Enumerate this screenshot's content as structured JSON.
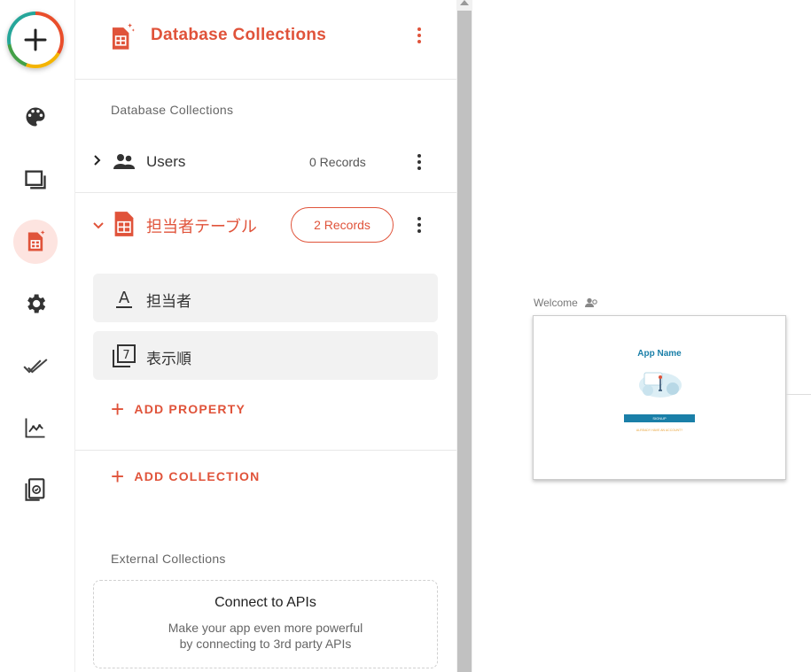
{
  "colors": {
    "accent": "#e0533a",
    "app_primary": "#1a7fa8",
    "active_bg": "#fde4e0"
  },
  "rail": {
    "add_icon": "plus-icon",
    "items": [
      {
        "name": "palette-icon"
      },
      {
        "name": "screens-icon"
      },
      {
        "name": "database-icon",
        "active": true
      },
      {
        "name": "gear-icon"
      },
      {
        "name": "double-check-icon"
      },
      {
        "name": "analytics-icon"
      },
      {
        "name": "publish-icon"
      }
    ]
  },
  "panel": {
    "title": "Database Collections",
    "section_label": "Database Collections",
    "collections": [
      {
        "label": "Users",
        "records": "0 Records",
        "expanded": false,
        "icon": "people-icon"
      },
      {
        "label": "担当者テーブル",
        "records": "2 Records",
        "expanded": true,
        "icon": "table-icon"
      }
    ],
    "properties": [
      {
        "label": "担当者",
        "icon": "text-icon"
      },
      {
        "label": "表示順",
        "icon": "number-icon",
        "icon_text": "7"
      }
    ],
    "add_property": "ADD PROPERTY",
    "add_collection": "ADD COLLECTION",
    "external_label": "External Collections",
    "api_card": {
      "title": "Connect to APIs",
      "line1": "Make your app even more powerful",
      "line2": "by connecting to 3rd party APIs"
    }
  },
  "canvas": {
    "screen_label": "Welcome",
    "app_name": "App Name",
    "button_text": "SIGNUP",
    "link_text": "ALREADY HAVE AN ACCOUNT?"
  }
}
